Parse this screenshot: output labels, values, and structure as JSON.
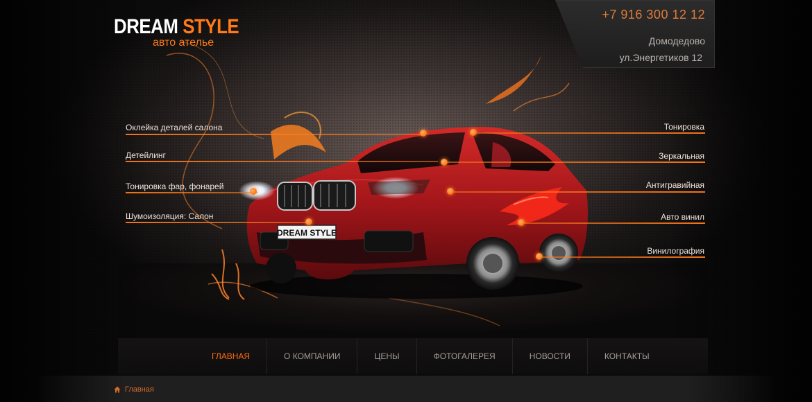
{
  "header": {
    "logo": {
      "word1": "DREAM",
      "word2": "STYLE",
      "tagline": "авто ателье"
    },
    "contact": {
      "phone": "+7 916 300 12 12",
      "city": "Домодедово",
      "address": "ул.Энергетиков 12"
    }
  },
  "services": {
    "left": [
      "Оклейка деталей салона",
      "Детейлинг",
      "Тонировка фар, фонарей",
      "Шумоизоляция: Салон"
    ],
    "right": [
      "Тонировка",
      "Зеркальная",
      "Антигравийная",
      "Авто винил",
      "Винилография"
    ]
  },
  "car": {
    "plate_text": "DREAM STYLE"
  },
  "nav": {
    "items": [
      "ГЛАВНАЯ",
      "О КОМПАНИИ",
      "ЦЕНЫ",
      "ФОТОГАЛЕРЕЯ",
      "НОВОСТИ",
      "КОНТАКТЫ"
    ],
    "active_index": 0
  },
  "breadcrumb": {
    "icon": "home-icon",
    "label": "Главная"
  },
  "colors": {
    "accent": "#ff7a1a",
    "car_red": "#a8151a",
    "bg_dark": "#0b0b0b"
  }
}
